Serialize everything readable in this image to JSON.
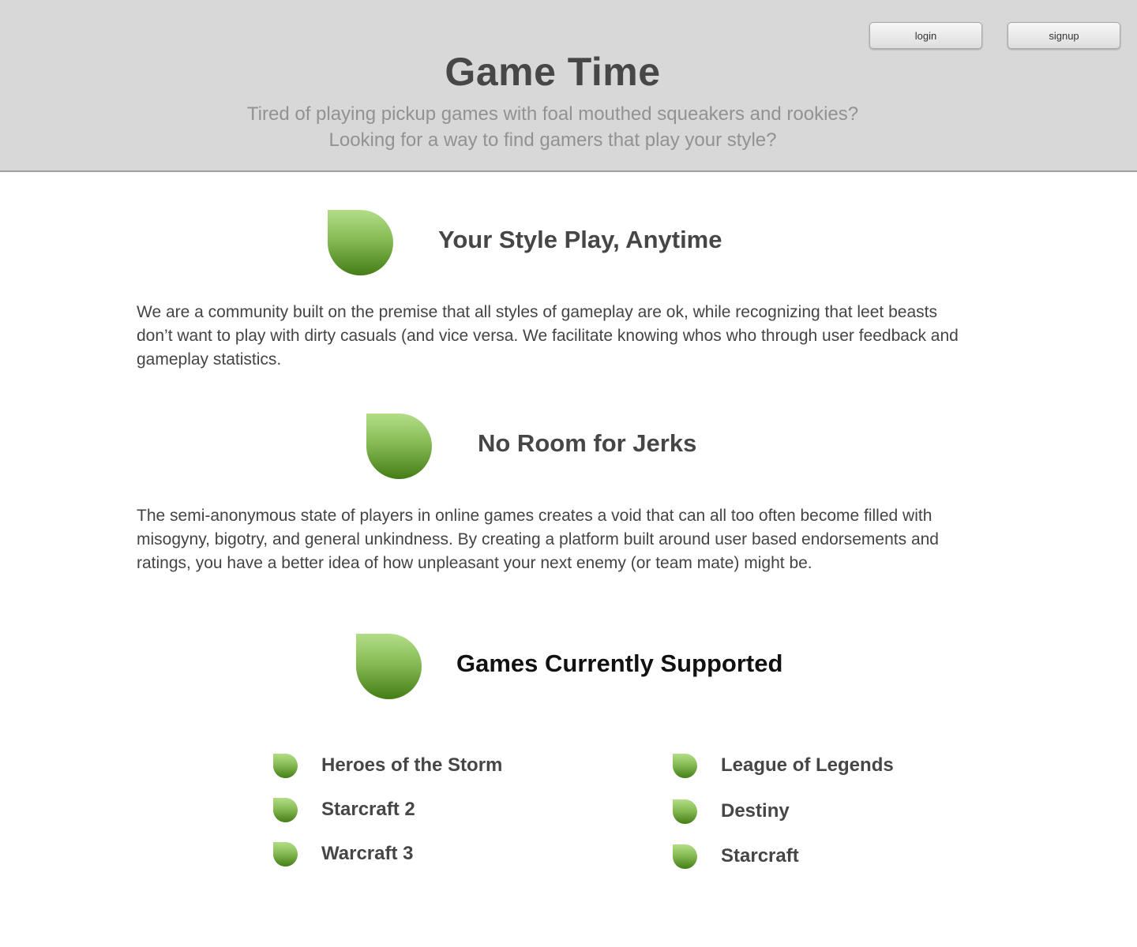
{
  "header": {
    "title": "Game Time",
    "tagline_line1": "Tired of playing pickup games with foal mouthed squeakers and rookies?",
    "tagline_line2": "Looking for a way to find gamers that play your style?",
    "login_label": "login",
    "signup_label": "signup"
  },
  "sections": [
    {
      "title": "Your Style Play, Anytime",
      "body": "We are a community built on the premise that all styles of gameplay are ok, while recognizing that leet beasts don’t want to play with dirty casuals (and vice versa.  We facilitate knowing whos who through user feedback and gameplay statistics."
    },
    {
      "title": "No Room for Jerks",
      "body": "The semi-anonymous state of players in online games creates a void that can all too often become filled with misogyny, bigotry, and general unkindness.  By creating a platform built around user based endorsements and ratings, you have a better idea of how unpleasant your next enemy (or team mate) might be."
    },
    {
      "title": "Games Currently Supported"
    }
  ],
  "games": {
    "left": [
      "Heroes of the Storm",
      "Starcraft 2",
      "Warcraft 3"
    ],
    "right": [
      "League of Legends",
      "Destiny",
      "Starcraft"
    ]
  },
  "icons": {
    "section_icon": "leaf-icon",
    "bullet_icon": "leaf-bullet-icon"
  },
  "colors": {
    "header_bg": "#d8d8d8",
    "leaf_top": "#b3dd87",
    "leaf_bottom": "#447d16",
    "heading": "#464646",
    "tagline": "#929292"
  }
}
